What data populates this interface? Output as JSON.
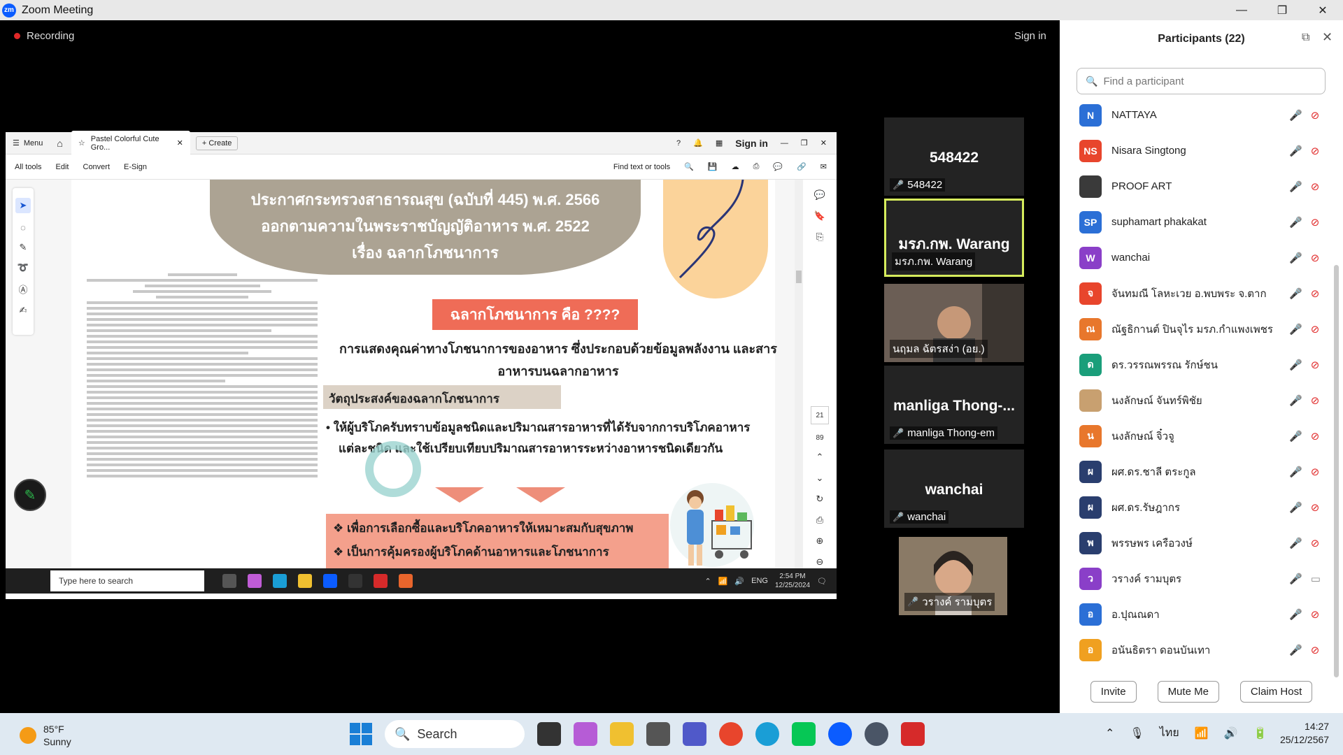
{
  "window": {
    "app_title": "Zoom Meeting",
    "min": "—",
    "restore": "❐",
    "close": "✕"
  },
  "meeting": {
    "recording_label": "Recording",
    "sign_in": "Sign in"
  },
  "acrobat": {
    "menu": "Menu",
    "tab_title": "Pastel Colorful Cute Gro...",
    "create": "+ Create",
    "sign_in": "Sign in",
    "toolbar": [
      "All tools",
      "Edit",
      "Convert",
      "E-Sign"
    ],
    "find": "Find text or tools",
    "page_current": "21",
    "page_total": "89"
  },
  "slide": {
    "title_lines": [
      "ประกาศกระทรวงสาธารณสุข (ฉบับที่ 445) พ.ศ. 2566",
      "ออกตามความในพระราชบัญญัติอาหาร พ.ศ. 2522",
      "เรื่อง ฉลากโภชนาการ"
    ],
    "heading": "ฉลากโภชนาการ คือ ????",
    "definition": "การแสดงคุณค่าทางโภชนาการของอาหาร ซึ่งประกอบด้วยข้อมูลพลังงาน และสารอาหารบนฉลากอาหาร",
    "objective_title": "วัตถุประสงค์ของฉลากโภชนาการ",
    "bullet": "• ให้ผู้บริโภครับทราบข้อมูลชนิดและปริมาณสารอาหารที่ได้รับจากการบริโภคอาหารแต่ละชนิด และใช้เปรียบเทียบปริมาณสารอาหารระหว่างอาหารชนิดเดียวกัน",
    "points": [
      "❖ เพื่อการเลือกซื้อและบริโภคอาหารให้เหมาะสมกับสุขภาพ",
      "❖ เป็นการคุ้มครองผู้บริโภคด้านอาหารและโภชนาการ"
    ]
  },
  "inner_taskbar": {
    "search": "Type here to search",
    "lang": "ENG",
    "time": "2:54 PM",
    "date": "12/25/2024"
  },
  "gallery": [
    {
      "big": "548422",
      "label": "548422"
    },
    {
      "big": "มรภ.กพ. Warang",
      "label": "มรภ.กพ. Warang"
    },
    {
      "big": "",
      "label": "นฤมล ฉัตรสง่า (อย.)"
    },
    {
      "big": "manliga  Thong-...",
      "label": "manliga Thong-em"
    },
    {
      "big": "wanchai",
      "label": "wanchai"
    },
    {
      "big": "",
      "label": "วรางค์ รามบุตร"
    }
  ],
  "participants_panel": {
    "title": "Participants (22)",
    "search_placeholder": "Find a participant",
    "buttons": [
      "Invite",
      "Mute Me",
      "Claim Host"
    ],
    "list": [
      {
        "initials": "N",
        "name": "NATTAYA",
        "color": "#2b6fd6"
      },
      {
        "initials": "NS",
        "name": "Nisara Singtong",
        "color": "#e8452c"
      },
      {
        "initials": "",
        "name": "PROOF ART",
        "color": "#3a3a3a"
      },
      {
        "initials": "SP",
        "name": "suphamart phakakat",
        "color": "#2b6fd6"
      },
      {
        "initials": "W",
        "name": "wanchai",
        "color": "#8a3fc8"
      },
      {
        "initials": "จ",
        "name": "จันทมณี โลหะเวย อ.พบพระ จ.ตาก",
        "color": "#e8452c"
      },
      {
        "initials": "ณ",
        "name": "ณัฐธิกานต์ ปินจุไร มรภ.กำแพงเพชร",
        "color": "#e8772c"
      },
      {
        "initials": "ด",
        "name": "ดร.วรรณพรรณ รักษ์ชน",
        "color": "#1a9e7a"
      },
      {
        "initials": "",
        "name": "นงลักษณ์ จันทร์พิชัย",
        "color": "#c8a070"
      },
      {
        "initials": "น",
        "name": "นงลักษณ์ จิ๋วจู",
        "color": "#e8772c"
      },
      {
        "initials": "ผ",
        "name": "ผศ.ดร.ชาลี ตระกูล",
        "color": "#2a3e6e"
      },
      {
        "initials": "ผ",
        "name": "ผศ.ดร.รัษฎากร",
        "color": "#2a3e6e"
      },
      {
        "initials": "พ",
        "name": "พรรษพร เครือวงษ์",
        "color": "#2a3e6e"
      },
      {
        "initials": "ว",
        "name": "วรางค์ รามบุตร",
        "color": "#8a3fc8"
      },
      {
        "initials": "อ",
        "name": "อ.ปุณณดา",
        "color": "#2b6fd6"
      },
      {
        "initials": "อ",
        "name": "อนันธิตรา  ดอนบันเทา",
        "color": "#f0a020"
      }
    ]
  },
  "taskbar": {
    "weather_temp": "85°F",
    "weather_desc": "Sunny",
    "search": "Search",
    "lang": "ไทย",
    "time": "14:27",
    "date": "25/12/2567"
  }
}
